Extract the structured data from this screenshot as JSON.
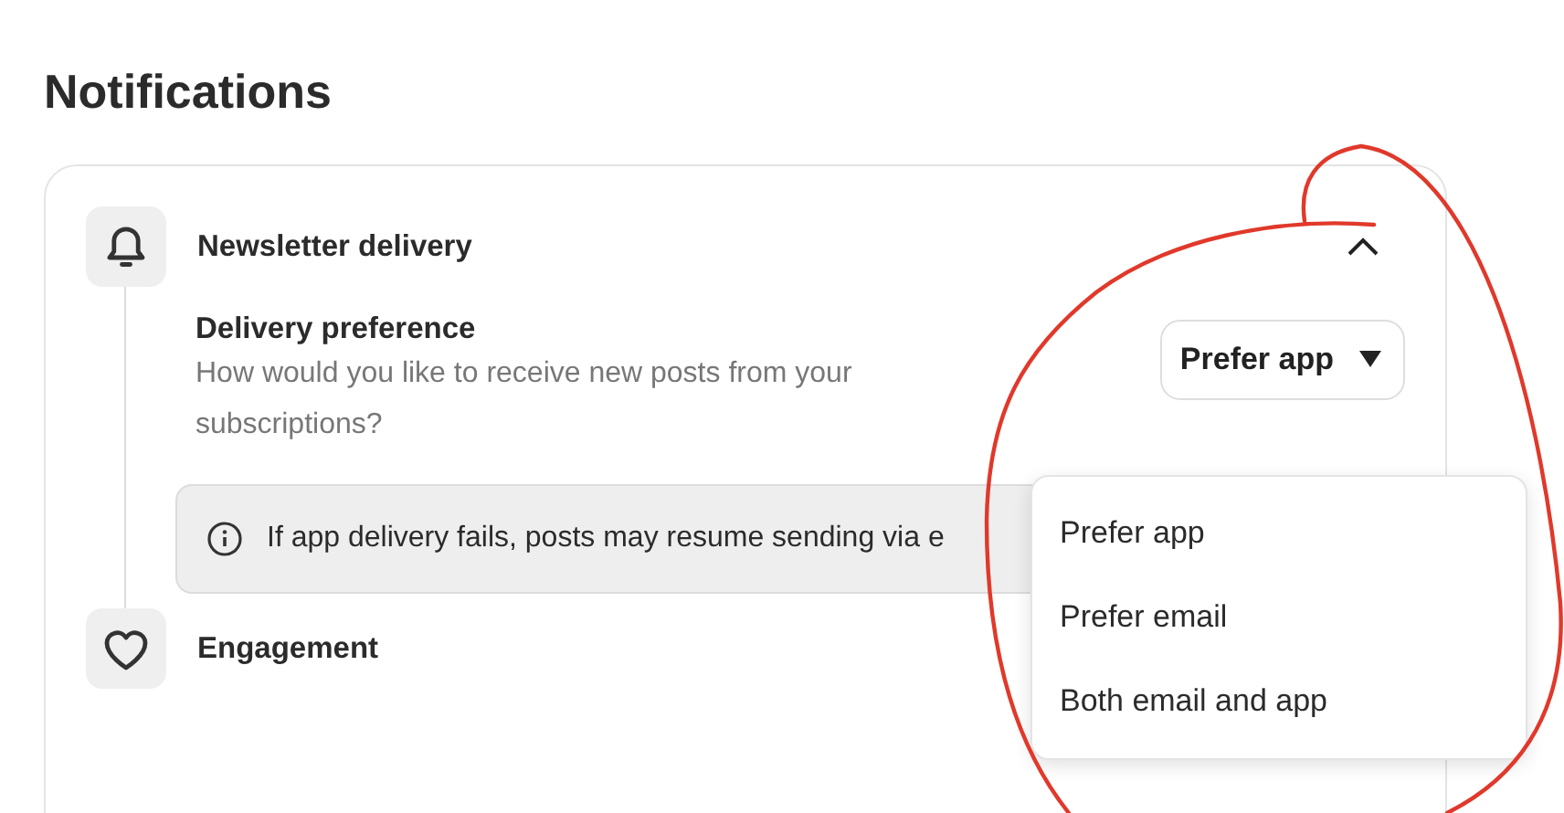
{
  "page_title": "Notifications",
  "sections": [
    {
      "kind": "bell",
      "title": "Newsletter delivery",
      "expanded": true,
      "setting": {
        "label": "Delivery preference",
        "description": "How would you like to receive new posts from your subscriptions?",
        "select": {
          "value": "Prefer app",
          "expanded": true,
          "options": [
            {
              "label": "Prefer app"
            },
            {
              "label": "Prefer email"
            },
            {
              "label": "Both email and app"
            }
          ]
        },
        "notice": "If app delivery fails, posts may resume sending via e"
      }
    },
    {
      "kind": "heart",
      "title": "Engagement"
    }
  ],
  "annotation": {
    "kind": "circle",
    "color": "#e0392b"
  }
}
